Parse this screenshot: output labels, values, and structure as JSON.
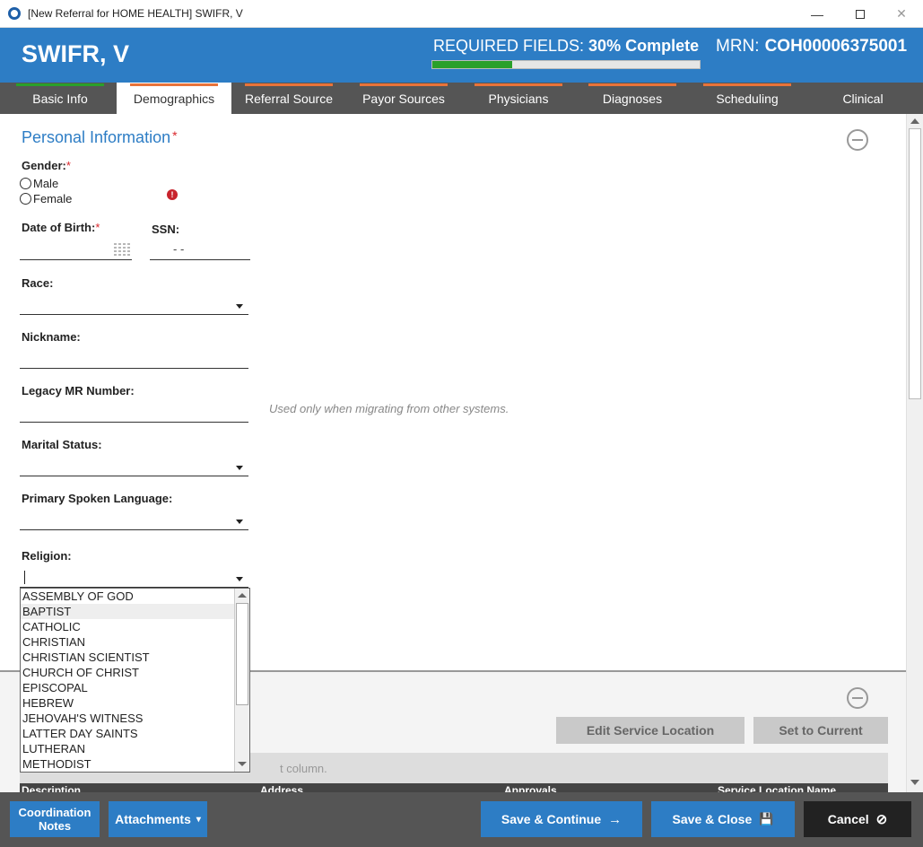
{
  "window": {
    "title": "[New Referral for HOME HEALTH] SWIFR, V",
    "minimize": "—",
    "close": "✕"
  },
  "header": {
    "patient_name": "SWIFR, V",
    "required_label": "REQUIRED FIELDS:",
    "required_value": "30% Complete",
    "progress": 0.3,
    "mrn_label": "MRN:",
    "mrn_value": "COH00006375001"
  },
  "tabs": [
    {
      "label": "Basic Info",
      "color": "#2aa02a"
    },
    {
      "label": "Demographics",
      "color": "#e8733a"
    },
    {
      "label": "Referral Source",
      "color": "#e8733a"
    },
    {
      "label": "Payor Sources",
      "color": "#e8733a"
    },
    {
      "label": "Physicians",
      "color": "#e8733a"
    },
    {
      "label": "Diagnoses",
      "color": "#e8733a"
    },
    {
      "label": "Scheduling",
      "color": "#e8733a"
    },
    {
      "label": "Clinical",
      "color": ""
    }
  ],
  "personal": {
    "title": "Personal Information",
    "req_star": "*",
    "gender_label": "Gender:",
    "gender_options": [
      "Male",
      "Female"
    ],
    "warn": "!",
    "dob_label": "Date of Birth:",
    "ssn_label": "SSN:",
    "ssn_placeholder": "-   -",
    "race_label": "Race:",
    "nickname_label": "Nickname:",
    "legacy_label": "Legacy MR Number:",
    "legacy_hint": "Used only when migrating from other systems.",
    "marital_label": "Marital Status:",
    "language_label": "Primary Spoken Language:",
    "religion_label": "Religion:"
  },
  "religion_options": [
    "ASSEMBLY OF GOD",
    "BAPTIST",
    "CATHOLIC",
    "CHRISTIAN",
    "CHRISTIAN SCIENTIST",
    "CHURCH OF CHRIST",
    "EPISCOPAL",
    "HEBREW",
    "JEHOVAH'S WITNESS",
    "LATTER DAY SAINTS",
    "LUTHERAN",
    "METHODIST"
  ],
  "religion_highlighted_index": 1,
  "lower": {
    "edit_button": "Edit Service Location",
    "set_button": "Set to Current",
    "group_hint": "t column.",
    "columns": [
      "Description",
      "Address",
      "Approvals",
      "Service Location Name"
    ]
  },
  "footer": {
    "coordination": "Coordination Notes",
    "attachments": "Attachments",
    "attachments_caret": "▾",
    "save_continue": "Save & Continue",
    "save_continue_icon": "→",
    "save_close": "Save & Close",
    "save_close_icon": "💾",
    "cancel": "Cancel",
    "cancel_icon": "⊘"
  }
}
